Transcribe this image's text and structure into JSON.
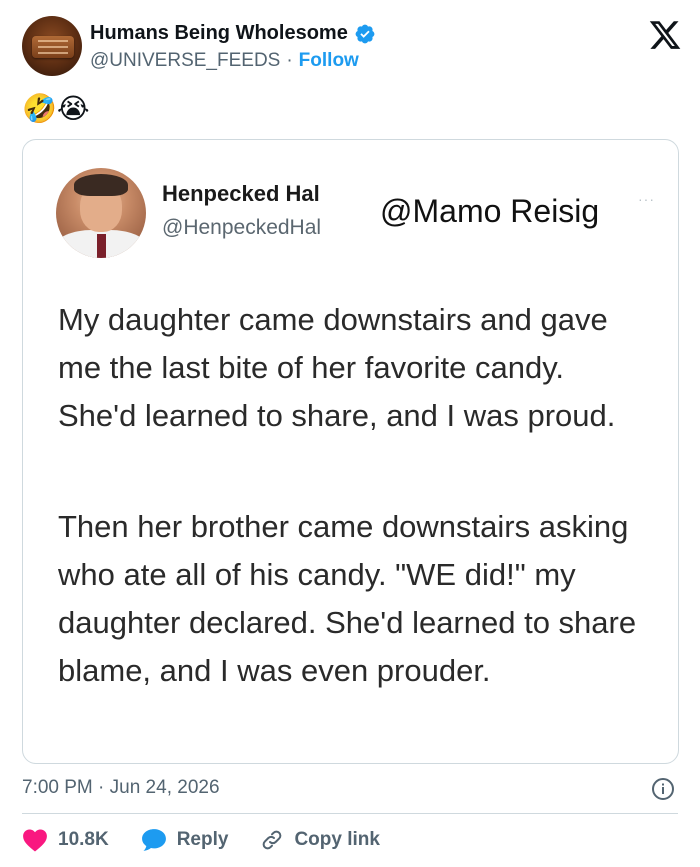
{
  "header": {
    "display_name": "Humans Being Wholesome",
    "handle": "@UNIVERSE_FEEDS",
    "separator": "·",
    "follow_label": "Follow"
  },
  "post": {
    "reaction_text": "🤣😭"
  },
  "quoted": {
    "name": "Henpecked Hal",
    "handle": "@HenpeckedHal",
    "mention": "@Mamo Reisig",
    "dots": "···",
    "paragraph1": "My daughter came downstairs and gave me the last bite of her favorite candy. She'd learned to share, and I was proud.",
    "paragraph2": "Then her brother came downstairs asking who ate all of his candy. \"WE did!\" my daughter declared. She'd learned to share blame, and I was even prouder."
  },
  "meta": {
    "timestamp": "7:00 PM · Jun 24, 2026"
  },
  "actions": {
    "like_count": "10.8K",
    "reply_label": "Reply",
    "copy_link_label": "Copy link"
  },
  "icons": {
    "verified": "verified-badge-icon",
    "x_logo": "x-logo-icon",
    "info": "info-icon",
    "like": "heart-icon",
    "reply": "speech-bubble-icon",
    "copy_link": "link-icon"
  },
  "colors": {
    "accent": "#1d9bf0",
    "like": "#f91880",
    "muted": "#536471",
    "border": "#cfd9de"
  }
}
